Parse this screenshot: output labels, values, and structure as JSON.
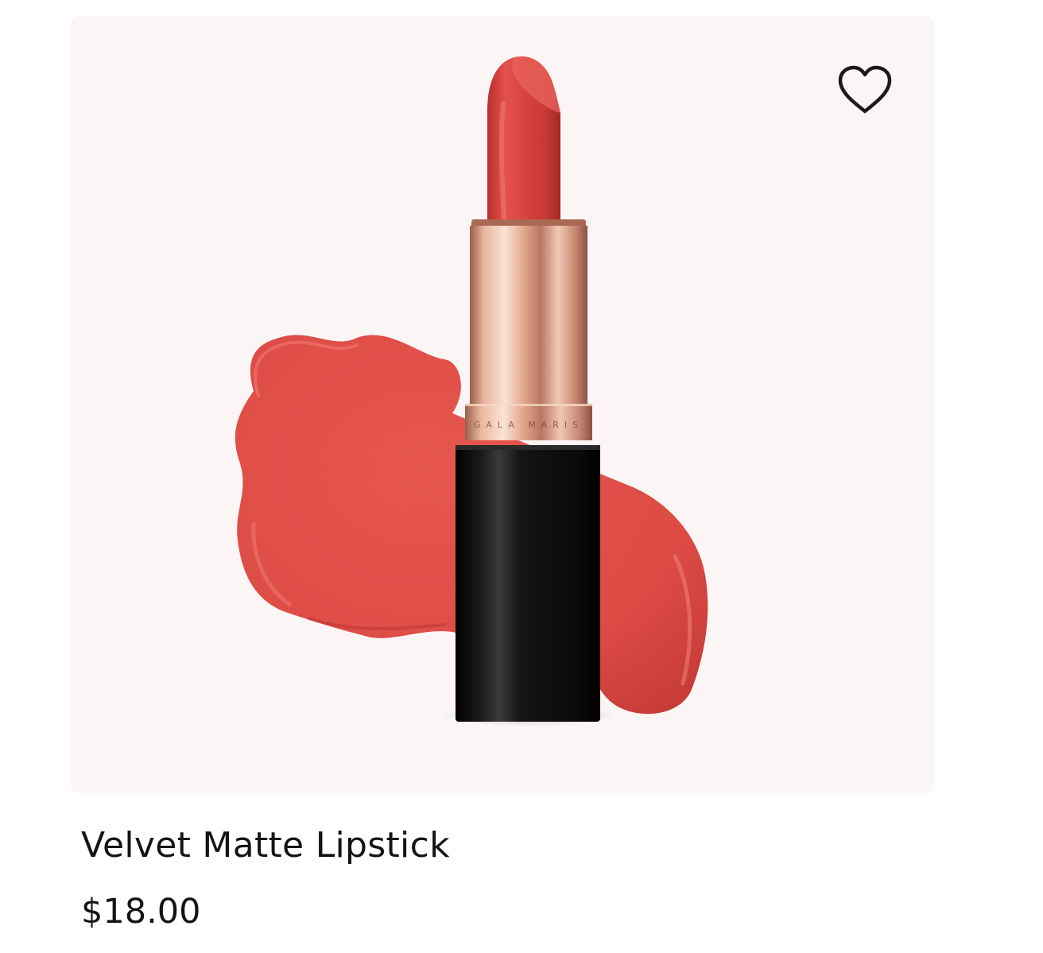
{
  "product": {
    "name": "Velvet Matte Lipstick",
    "price": "$18.00",
    "brand_engraving": "GALA MARIS",
    "image_alt": "red lipstick with swatch"
  },
  "wishlist": {
    "icon": "heart-outline-icon",
    "state": "not-favorited"
  },
  "colors": {
    "background": "#fbf6f5",
    "lipstick_bullet": "#d8423e",
    "swatch": "#df4e48",
    "tube_black": "#0d0d0d",
    "rose_gold": "#e7b39c",
    "text": "#141414"
  }
}
